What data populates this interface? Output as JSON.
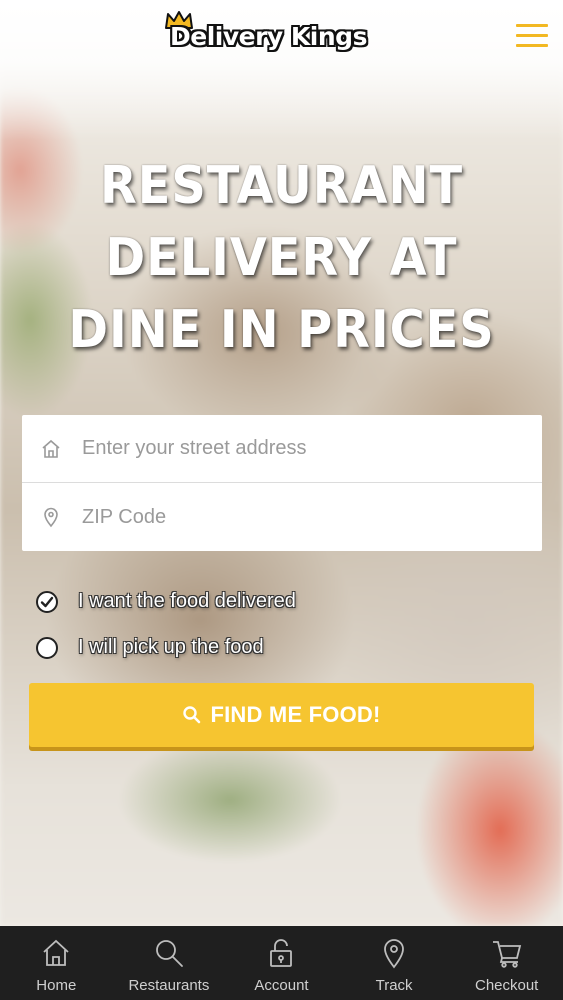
{
  "header": {
    "logo_text": "Delivery Kings",
    "brand_color": "#f2b822"
  },
  "hero": {
    "line1": "RESTAURANT",
    "line2": "DELIVERY AT",
    "line3": "DINE IN PRICES"
  },
  "form": {
    "address_placeholder": "Enter your street address",
    "address_value": "",
    "zip_placeholder": "ZIP Code",
    "zip_value": "",
    "address_icon": "home-icon",
    "zip_icon": "location-pin-icon"
  },
  "options": [
    {
      "label": "I want the food delivered",
      "selected": true
    },
    {
      "label": "I will pick up the food",
      "selected": false
    }
  ],
  "cta": {
    "label": "FIND ME FOOD!",
    "icon": "search-icon",
    "color": "#f6c530"
  },
  "tabbar": {
    "items": [
      {
        "label": "Home",
        "icon": "home-icon"
      },
      {
        "label": "Restaurants",
        "icon": "search-icon"
      },
      {
        "label": "Account",
        "icon": "lock-icon"
      },
      {
        "label": "Track",
        "icon": "location-pin-icon"
      },
      {
        "label": "Checkout",
        "icon": "cart-icon"
      }
    ]
  }
}
